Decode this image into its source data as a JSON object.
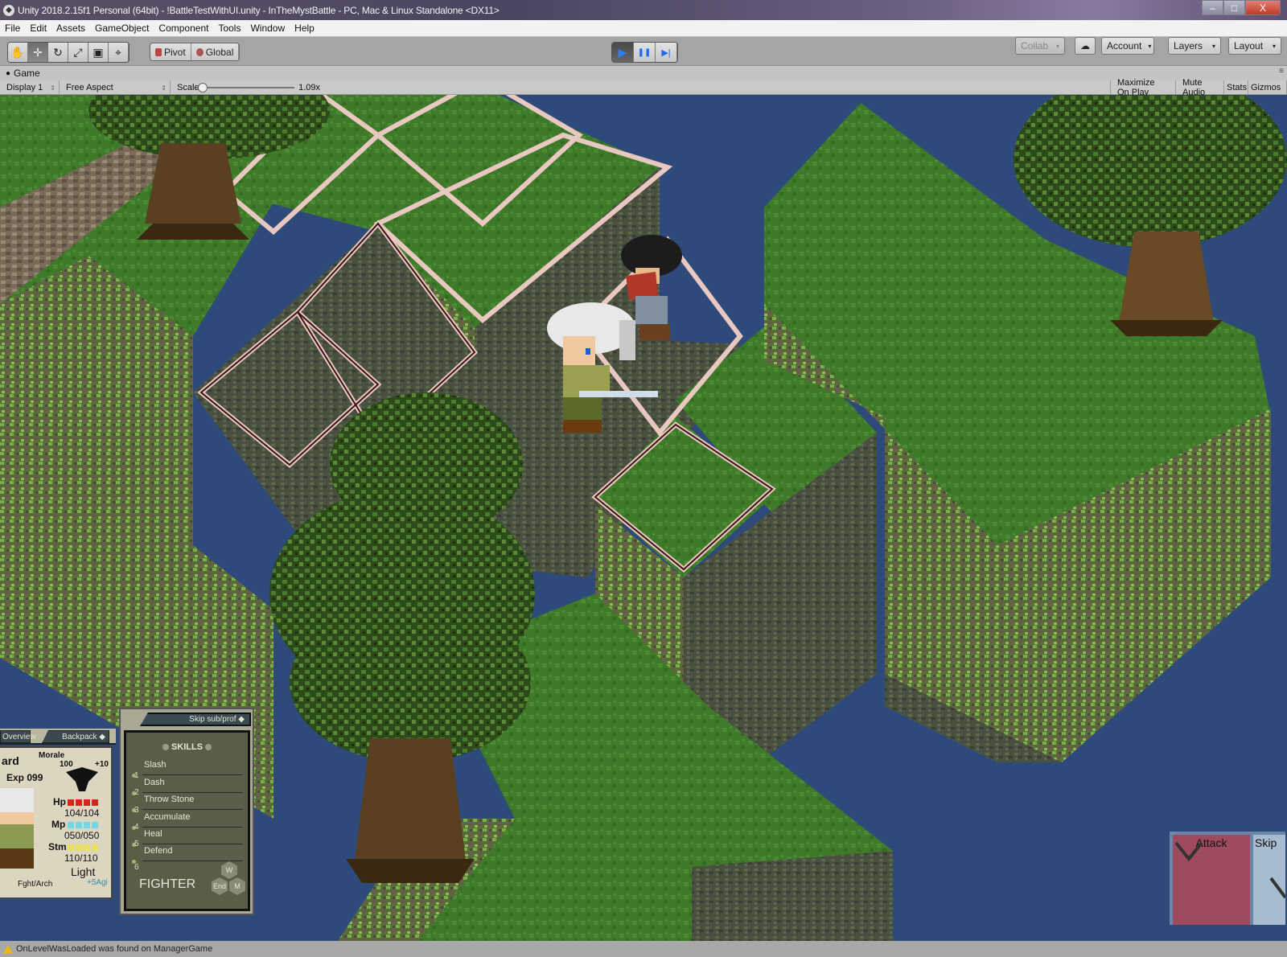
{
  "window": {
    "title": "Unity 2018.2.15f1 Personal (64bit) - !BattleTestWithUI.unity - InTheMystBattle - PC, Mac & Linux Standalone <DX11>",
    "controls": {
      "minimize": "–",
      "restore": "□",
      "close": "X"
    }
  },
  "menu": [
    "File",
    "Edit",
    "Assets",
    "GameObject",
    "Component",
    "Tools",
    "Window",
    "Help"
  ],
  "toolbar": {
    "tools": [
      {
        "name": "hand-tool",
        "glyph": "✋",
        "active": false
      },
      {
        "name": "move-tool",
        "glyph": "✛",
        "active": true
      },
      {
        "name": "rotate-tool",
        "glyph": "↻",
        "active": false
      },
      {
        "name": "scale-tool",
        "glyph": "⤢",
        "active": false
      },
      {
        "name": "rect-tool",
        "glyph": "▣",
        "active": false
      },
      {
        "name": "transform-tool",
        "glyph": "⌖",
        "active": false
      }
    ],
    "pivot_label": "Pivot",
    "global_label": "Global",
    "play": {
      "play": "▶",
      "pause": "❚❚",
      "step": "▶|",
      "playing": true
    },
    "collab_label": "Collab",
    "cloud_glyph": "☁",
    "account_label": "Account",
    "layers_label": "Layers",
    "layout_label": "Layout",
    "dropdown_glyph": "▾"
  },
  "game_view": {
    "tab_label": "Game",
    "display_label": "Display 1",
    "aspect_label": "Free Aspect",
    "scale_label": "Scale",
    "scale_value": "1.09x",
    "scale_fraction": 0.02,
    "toggles": [
      "Maximize On Play",
      "Mute Audio",
      "Stats",
      "Gizmos"
    ],
    "background_color": "#2e4a7a"
  },
  "hud": {
    "character_panel": {
      "tabs": [
        "Overview",
        "Backpack"
      ],
      "name_fragment": "ard",
      "level_exp": "Exp 099",
      "morale_label": "Morale",
      "morale_value": "100",
      "morale_bonus": "+10",
      "hp_label": "Hp",
      "hp_value": "104/104",
      "hp_fraction": 1.0,
      "mp_label": "Mp",
      "mp_value": "050/050",
      "mp_fraction": 1.0,
      "stm_label": "Stm",
      "stm_value": "110/110",
      "stm_fraction": 1.0,
      "class": "Fght/Arch",
      "weight": "Light",
      "bonus": "+5Agi",
      "colors": {
        "hp": "#e02020",
        "mp": "#70d8e8",
        "stm": "#e8e060"
      }
    },
    "skill_panel": {
      "tab_label": "Skip sub/prof",
      "header": "SKILLS",
      "skills": [
        {
          "num": "",
          "name": "Slash"
        },
        {
          "num": "1",
          "name": "Dash"
        },
        {
          "num": "2",
          "name": "Throw Stone"
        },
        {
          "num": "3",
          "name": "Accumulate"
        },
        {
          "num": "4",
          "name": "Heal"
        },
        {
          "num": "5",
          "name": "Defend"
        }
      ],
      "last_num": "6",
      "class_name": "FIGHTER",
      "hex_buttons": [
        "W",
        "End",
        "M"
      ]
    },
    "actions": {
      "attack_label": "Attack",
      "skip_label": "Skip",
      "attack_color": "#a04a60",
      "skip_color": "#a8bcd0"
    }
  },
  "console": {
    "message": "OnLevelWasLoaded was found on ManagerGame"
  }
}
